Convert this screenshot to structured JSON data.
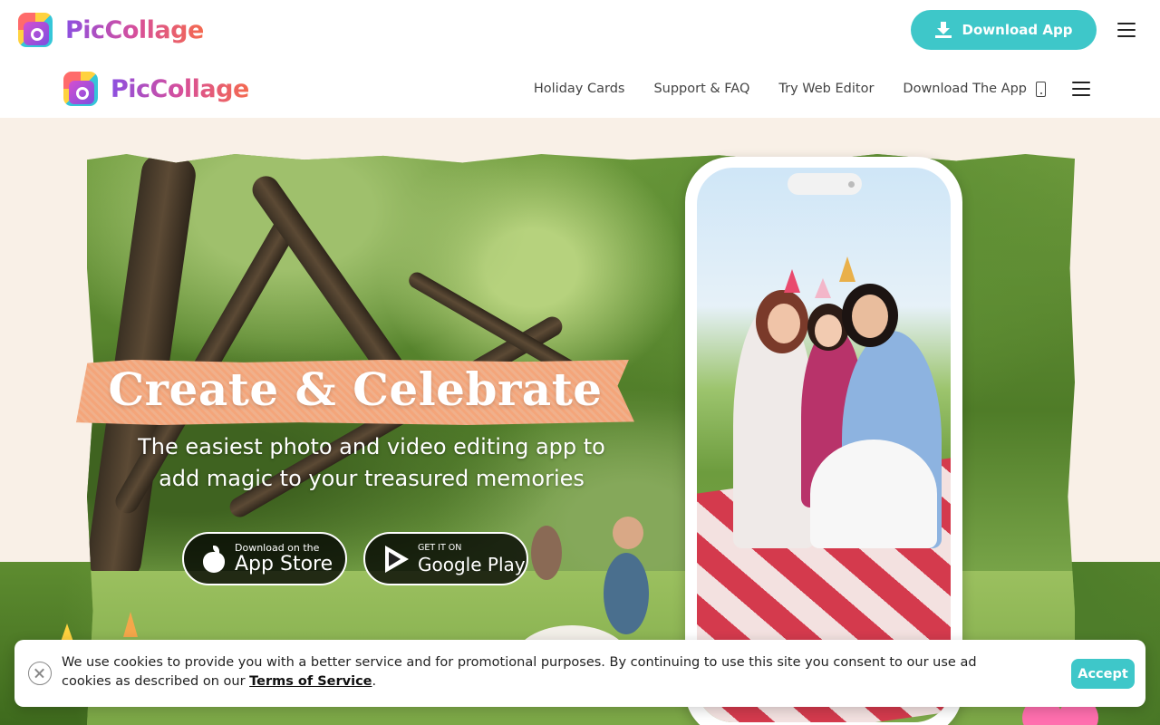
{
  "topbar": {
    "logo_text": "PicCollage",
    "download_button": "Download App"
  },
  "navbar": {
    "logo_text": "PicCollage",
    "links": [
      "Holiday Cards",
      "Support & FAQ",
      "Try Web Editor",
      "Download The App"
    ]
  },
  "hero": {
    "title": "Create & Celebrate",
    "subtitle_line1": "The easiest photo and video editing app to",
    "subtitle_line2": "add magic to your treasured memories",
    "app_store": {
      "small": "Download on the",
      "big": "App Store"
    },
    "google_play": {
      "small": "GET IT ON",
      "big": "Google Play"
    }
  },
  "cookie": {
    "text": "We use cookies to provide you with a better service and for promotional purposes. By continuing to use this site you consent to our use ad cookies as described on our ",
    "link": "Terms of Service",
    "end": ".",
    "accept": "Accept"
  },
  "colors": {
    "accent": "#3ec7c9",
    "hero_bg": "#f9f0e7",
    "tape": "#f4a57a"
  },
  "icons": [
    "download-icon",
    "menu-icon",
    "phone-icon",
    "apple-icon",
    "google-play-icon",
    "close-icon"
  ]
}
